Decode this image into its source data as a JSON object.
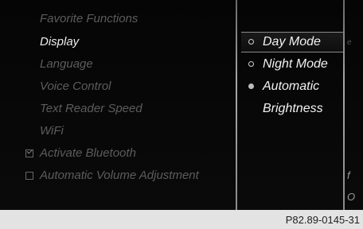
{
  "menu": {
    "items": [
      {
        "label": "Favorite Functions"
      },
      {
        "label": "Display"
      },
      {
        "label": "Language"
      },
      {
        "label": "Voice Control"
      },
      {
        "label": "Text Reader Speed"
      },
      {
        "label": "WiFi"
      },
      {
        "label": "Activate Bluetooth",
        "checked": true
      },
      {
        "label": "Automatic Volume Adjustment",
        "checked": false
      }
    ]
  },
  "submenu": {
    "items": [
      {
        "label": "Day Mode"
      },
      {
        "label": "Night Mode"
      },
      {
        "label": "Automatic",
        "selected": true
      },
      {
        "label": "Brightness"
      }
    ]
  },
  "right_edge": {
    "glyph_top": "e",
    "glyph_mid": "f",
    "glyph_bottom": "O"
  },
  "footer": {
    "image_code": "P82.89-0145-31"
  }
}
